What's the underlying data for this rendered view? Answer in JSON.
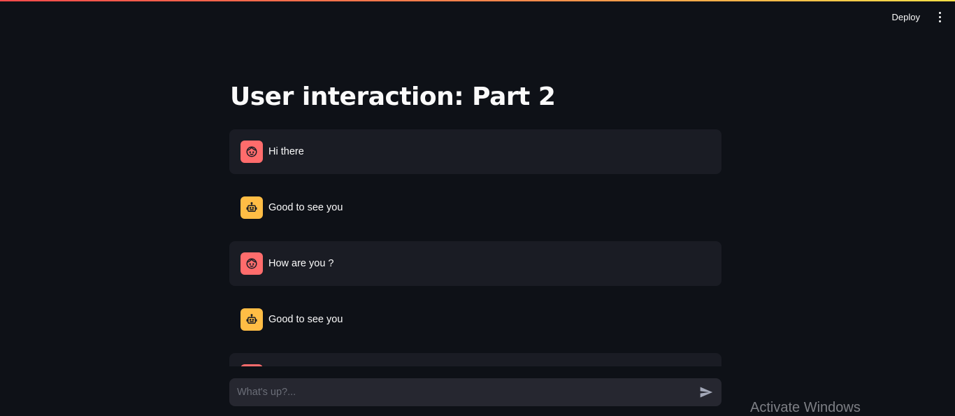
{
  "header": {
    "deploy_label": "Deploy",
    "menu_icon": "more-vert-icon"
  },
  "main": {
    "title": "User interaction: Part 2",
    "messages": [
      {
        "role": "user",
        "avatar_icon": "user-face-icon",
        "text": "Hi there"
      },
      {
        "role": "assistant",
        "avatar_icon": "robot-icon",
        "text": "Good to see you"
      },
      {
        "role": "user",
        "avatar_icon": "user-face-icon",
        "text": "How are you ?"
      },
      {
        "role": "assistant",
        "avatar_icon": "robot-icon",
        "text": "Good to see you"
      },
      {
        "role": "user",
        "avatar_icon": "user-face-icon",
        "text": ""
      }
    ]
  },
  "chat_input": {
    "placeholder": "What's up?...",
    "value": "",
    "send_icon": "send-icon"
  },
  "os_overlay": {
    "watermark": "Activate Windows"
  },
  "colors": {
    "background": "#0e1117",
    "user_message_bg": "#1a1c24",
    "user_avatar": "#ff6c6c",
    "assistant_avatar": "#ffbd45",
    "input_bg": "#262730"
  }
}
